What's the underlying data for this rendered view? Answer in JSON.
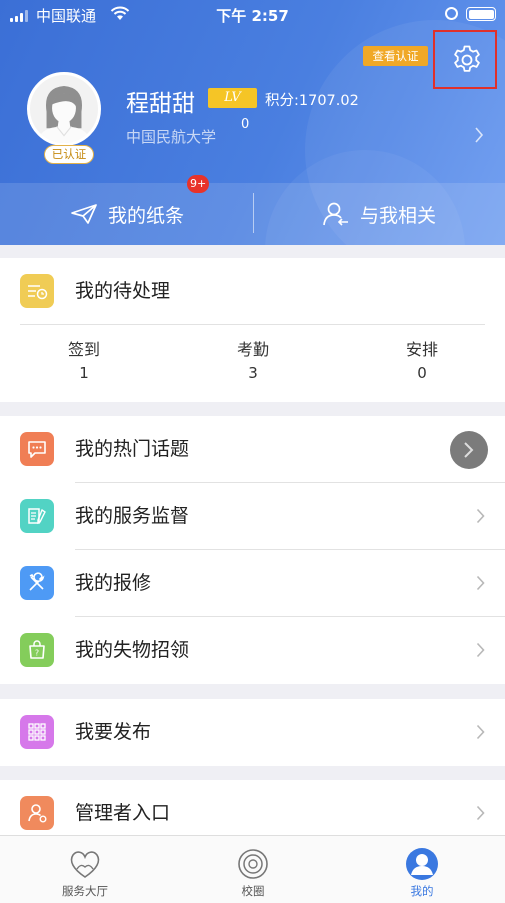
{
  "status_bar": {
    "carrier": "中国联通",
    "time": "下午 2:57"
  },
  "profile": {
    "view_cert_label": "查看认证",
    "username": "程甜甜",
    "level_badge": "LV",
    "points": "积分:1707.02",
    "count": "0",
    "school": "中国民航大学",
    "verified_badge": "已认证"
  },
  "header_actions": {
    "notes_label": "我的纸条",
    "notes_badge": "9+",
    "related_label": "与我相关"
  },
  "pending": {
    "title": "我的待处理",
    "stats": [
      {
        "label": "签到",
        "value": "1"
      },
      {
        "label": "考勤",
        "value": "3"
      },
      {
        "label": "安排",
        "value": "0"
      }
    ]
  },
  "menu_group_1": [
    {
      "label": "我的热门话题",
      "icon": "chat-bubble-icon",
      "color": "#f07e55"
    },
    {
      "label": "我的服务监督",
      "icon": "document-pen-icon",
      "color": "#52d3c4"
    },
    {
      "label": "我的报修",
      "icon": "wrench-icon",
      "color": "#4e9af5"
    },
    {
      "label": "我的失物招领",
      "icon": "lost-bag-icon",
      "color": "#84cd5b"
    }
  ],
  "menu_group_2": [
    {
      "label": "我要发布",
      "icon": "grid-icon",
      "color": "#d678ea"
    }
  ],
  "menu_group_3": [
    {
      "label": "管理者入口",
      "icon": "admin-user-icon",
      "color": "#f08a5d"
    }
  ],
  "tabbar": {
    "items": [
      {
        "label": "服务大厅"
      },
      {
        "label": "校圈"
      },
      {
        "label": "我的"
      }
    ],
    "active_color": "#3a78e0"
  }
}
